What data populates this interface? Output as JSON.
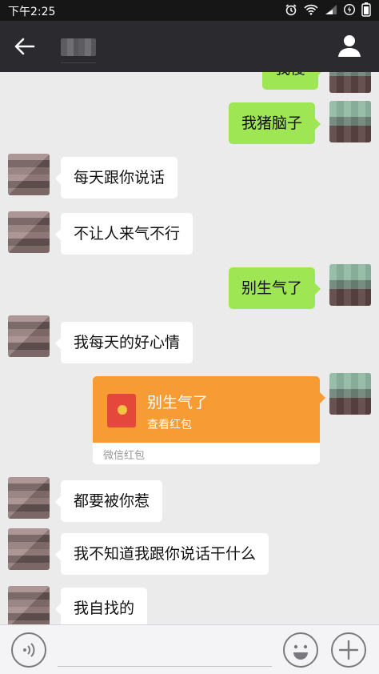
{
  "status_bar": {
    "time": "下午2:25"
  },
  "nav": {
    "contact_name": "██",
    "colors": {
      "nav_bg": "#2b2b2f",
      "status_bg": "#161616"
    }
  },
  "messages": [
    {
      "side": "right",
      "type": "text",
      "text": "我傻"
    },
    {
      "side": "right",
      "type": "text",
      "text": "我猪脑子"
    },
    {
      "side": "left",
      "type": "text",
      "text": "每天跟你说话"
    },
    {
      "side": "left",
      "type": "text",
      "text": "不让人来气不行"
    },
    {
      "side": "right",
      "type": "text",
      "text": "别生气了"
    },
    {
      "side": "left",
      "type": "text",
      "text": "我每天的好心情"
    },
    {
      "side": "right",
      "type": "red_packet",
      "title": "别生气了",
      "subtitle": "查看红包",
      "footer": "微信红包"
    },
    {
      "side": "left",
      "type": "text",
      "text": "都要被你惹"
    },
    {
      "side": "left",
      "type": "text",
      "text": "我不知道我跟你说话干什么"
    },
    {
      "side": "left",
      "type": "text",
      "text": "我自找的"
    }
  ],
  "input_bar": {
    "placeholder": "",
    "value": ""
  },
  "colors": {
    "chat_bg": "#ebebeb",
    "bubble_self": "#9ee654",
    "bubble_other": "#ffffff",
    "red_packet": "#f79b35"
  },
  "icons": [
    "back-arrow-icon",
    "profile-icon",
    "alarm-icon",
    "wifi-icon",
    "signal-icon",
    "battery-icon",
    "voice-icon",
    "emoji-icon",
    "plus-icon"
  ]
}
